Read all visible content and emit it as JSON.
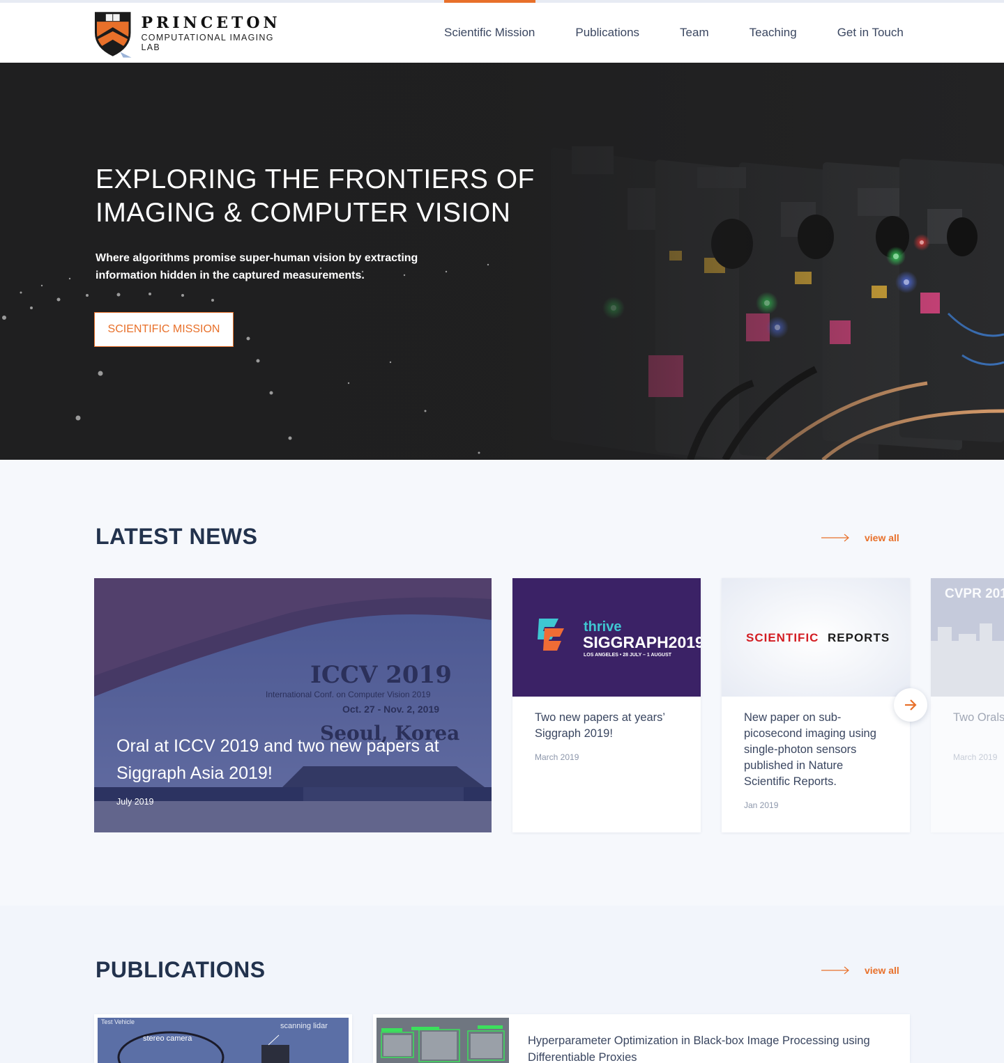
{
  "header": {
    "logo_title": "PRINCETON",
    "logo_subtitle": "COMPUTATIONAL IMAGING LAB",
    "nav": [
      {
        "label": "Scientific Mission",
        "active": true
      },
      {
        "label": "Publications",
        "active": false
      },
      {
        "label": "Team",
        "active": false
      },
      {
        "label": "Teaching",
        "active": false
      },
      {
        "label": "Get in Touch",
        "active": false
      }
    ]
  },
  "hero": {
    "title": "EXPLORING THE FRONTIERS OF IMAGING & COMPUTER VISION",
    "subtitle": "Where algorithms promise super-human vision by extracting information hidden in the captured measurements.",
    "button": "SCIENTIFIC MISSION"
  },
  "news": {
    "heading": "LATEST NEWS",
    "view_all": "view all",
    "feature": {
      "image_heading": "ICCV 2019",
      "image_line1": "International Conf. on Computer Vision 2019",
      "image_line2": "Oct. 27 - Nov. 2, 2019",
      "image_line3": "Seoul, Korea",
      "title": "Oral at ICCV 2019 and two new papers at Siggraph Asia 2019!",
      "date": "July 2019"
    },
    "cards": [
      {
        "logo_top": "thrive",
        "logo_main": "SIGGRAPH2019",
        "logo_sub": "LOS ANGELES • 28 JULY – 1 AUGUST",
        "title": "Two new papers at years’ Siggraph 2019!",
        "date": "March 2019"
      },
      {
        "logo_a": "SCIENTIFIC",
        "logo_b": "REPORTS",
        "title": "New paper on sub-picosecond imaging using single-photon sensors published in Nature Scientific Reports.",
        "date": "Jan 2019"
      },
      {
        "image_text": "CVPR 201",
        "title": "Two Orals years’ CVF",
        "date": "March 2019"
      }
    ]
  },
  "publications": {
    "heading": "PUBLICATIONS",
    "view_all": "view all",
    "items": [
      {
        "image_labels": [
          "Test Vehicle",
          "scanning lidar",
          "stereo camera"
        ]
      },
      {
        "title": "Hyperparameter Optimization in Black-box Image Processing using Differentiable Proxies"
      }
    ]
  },
  "colors": {
    "accent": "#e8702a",
    "heading": "#22324d",
    "hero_bg": "#1f1f20"
  }
}
